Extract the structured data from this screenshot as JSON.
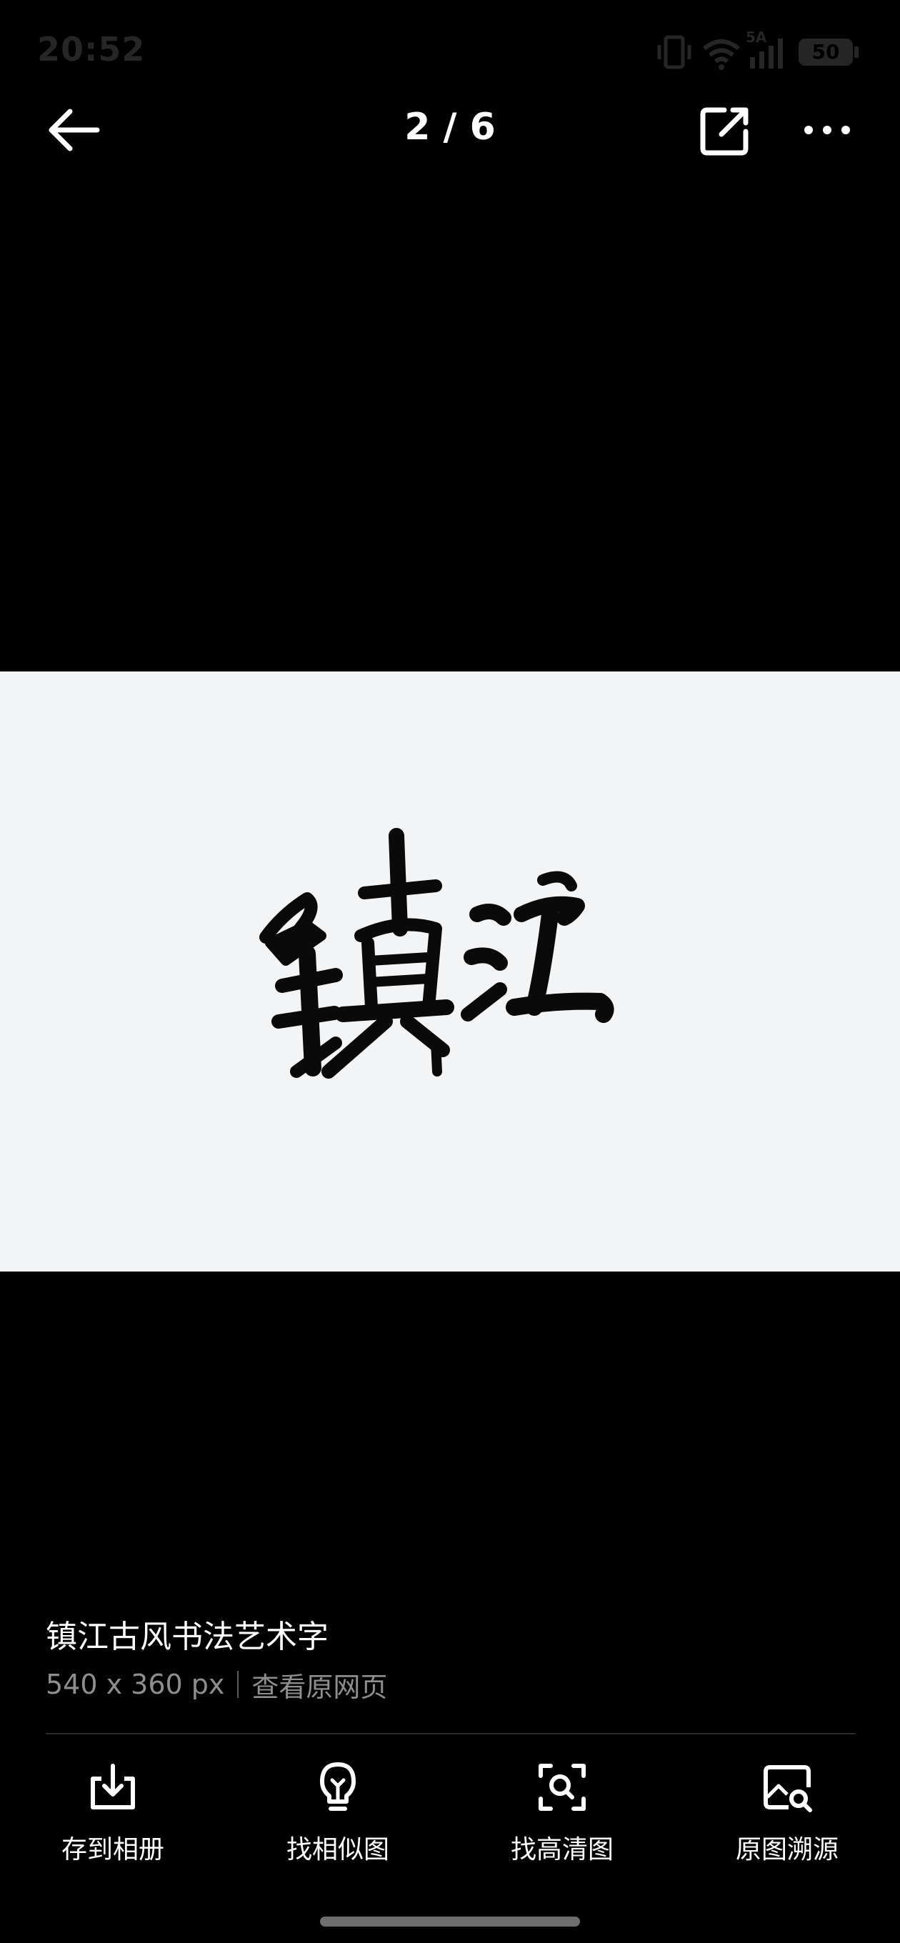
{
  "status_bar": {
    "time": "20:52",
    "network_label": "5A",
    "battery": "50"
  },
  "top_nav": {
    "page_counter": "2 / 6"
  },
  "image": {
    "calligraphy_text": "镇江",
    "background_color": "#f3f4f6"
  },
  "info": {
    "title": "镇江古风书法艺术字",
    "dimensions": "540 x 360 px",
    "view_source_label": "查看原网页"
  },
  "actions": [
    {
      "label": "存到相册",
      "icon": "download-icon"
    },
    {
      "label": "找相似图",
      "icon": "lightbulb-icon"
    },
    {
      "label": "找高清图",
      "icon": "scan-search-icon"
    },
    {
      "label": "原图溯源",
      "icon": "image-search-icon"
    }
  ]
}
